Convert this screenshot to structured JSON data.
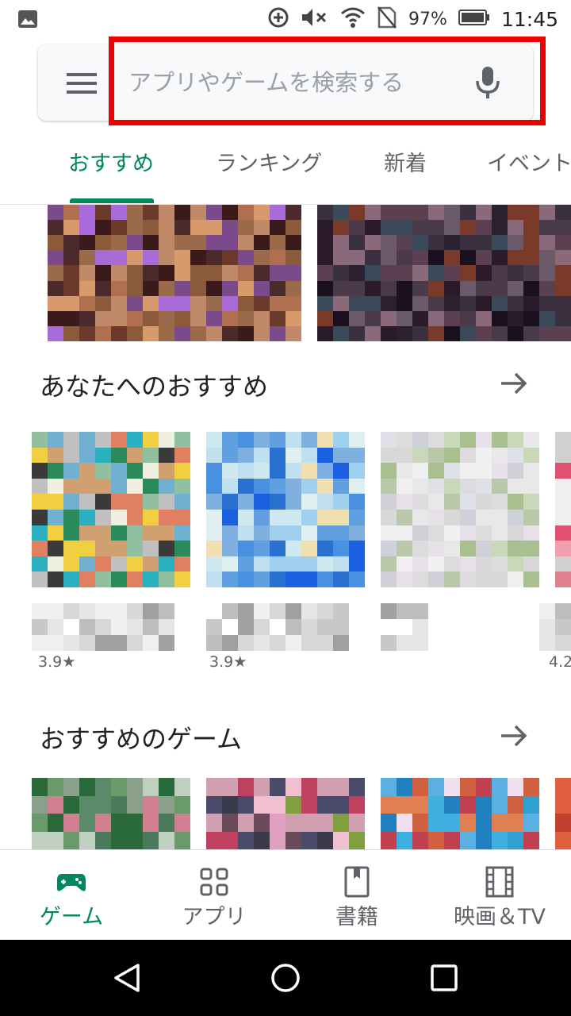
{
  "status_bar": {
    "battery": "97%",
    "time": "11:45"
  },
  "search": {
    "placeholder": "アプリやゲームを検索する"
  },
  "tabs": [
    {
      "label": "おすすめ"
    },
    {
      "label": "ランキング"
    },
    {
      "label": "新着"
    },
    {
      "label": "イベント"
    }
  ],
  "sections": {
    "for_you": {
      "title": "あなたへのおすすめ",
      "ratings": [
        "3.9★",
        "3.9★",
        "4.2"
      ]
    },
    "games": {
      "title": "おすすめのゲーム"
    }
  },
  "bottom_nav": [
    {
      "label": "ゲーム",
      "icon": "gamepad-icon"
    },
    {
      "label": "アプリ",
      "icon": "apps-grid-icon"
    },
    {
      "label": "書籍",
      "icon": "book-icon"
    },
    {
      "label": "映画＆TV",
      "icon": "film-icon"
    }
  ],
  "colors": {
    "accent": "#01875f",
    "highlight": "#ee0000"
  }
}
